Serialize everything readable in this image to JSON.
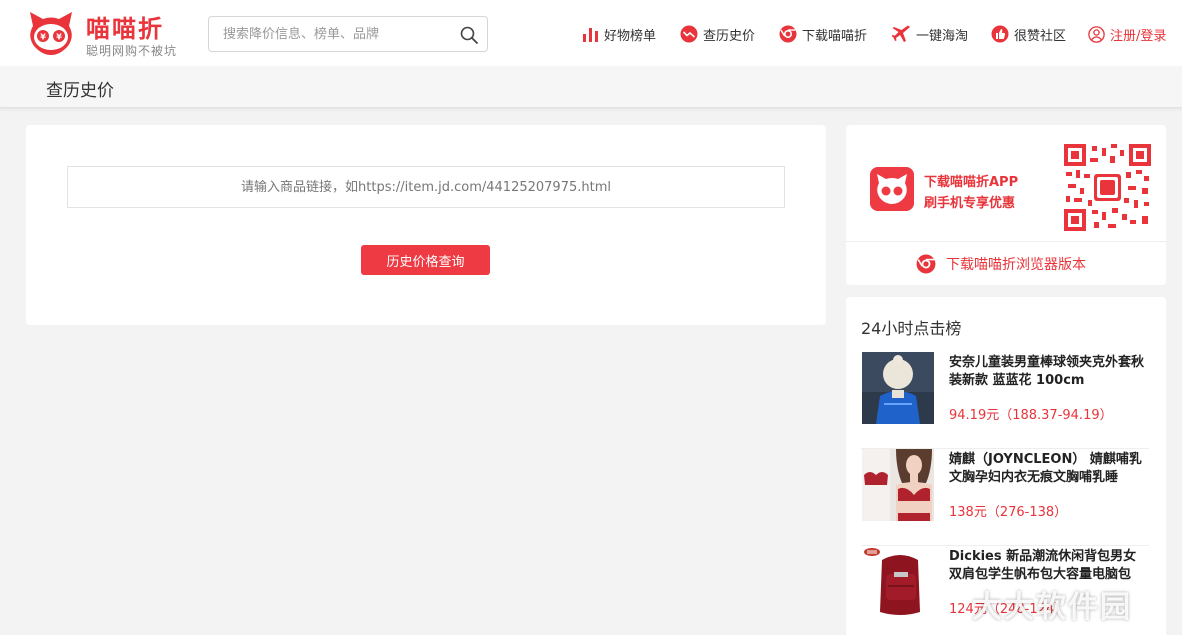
{
  "header": {
    "brand": "喵喵折",
    "slogan": "聪明网购不被坑",
    "search_placeholder": "搜索降价信息、榜单、品牌",
    "nav": [
      {
        "label": "好物榜单",
        "icon": "bar-chart-icon"
      },
      {
        "label": "查历史价",
        "icon": "price-trend-icon"
      },
      {
        "label": "下载喵喵折",
        "icon": "browser-icon"
      },
      {
        "label": "一键海淘",
        "icon": "airplane-icon"
      },
      {
        "label": "很赞社区",
        "icon": "thumbs-up-icon"
      },
      {
        "label": "注册/登录",
        "icon": "user-icon"
      }
    ]
  },
  "page": {
    "title": "查历史价",
    "url_placeholder": "请输入商品链接，如https://item.jd.com/44125207975.html",
    "query_button": "历史价格查询"
  },
  "sidebar": {
    "app_line1": "下载喵喵折APP",
    "app_line2": "刷手机专享优惠",
    "browser_link": "下载喵喵折浏览器版本",
    "ranking_title": "24小时点击榜",
    "ranking": [
      {
        "title": "安奈儿童装男童棒球领夹克外套秋装新款 蓝蓝花 100cm",
        "price": "94.19元（188.37-94.19）"
      },
      {
        "title": "婧麒（JOYNCLEON） 婧麒哺乳文胸孕妇内衣无痕文胸哺乳睡",
        "price": "138元（276-138）"
      },
      {
        "title": "Dickies 新品潮流休闲背包男女双肩包学生帆布包大容量电脑包",
        "price": "124元（248-124）"
      }
    ]
  },
  "watermark": "大大软件园",
  "colors": {
    "accent": "#e8343a",
    "button": "#ee3a43",
    "background": "#f3f3f3"
  }
}
